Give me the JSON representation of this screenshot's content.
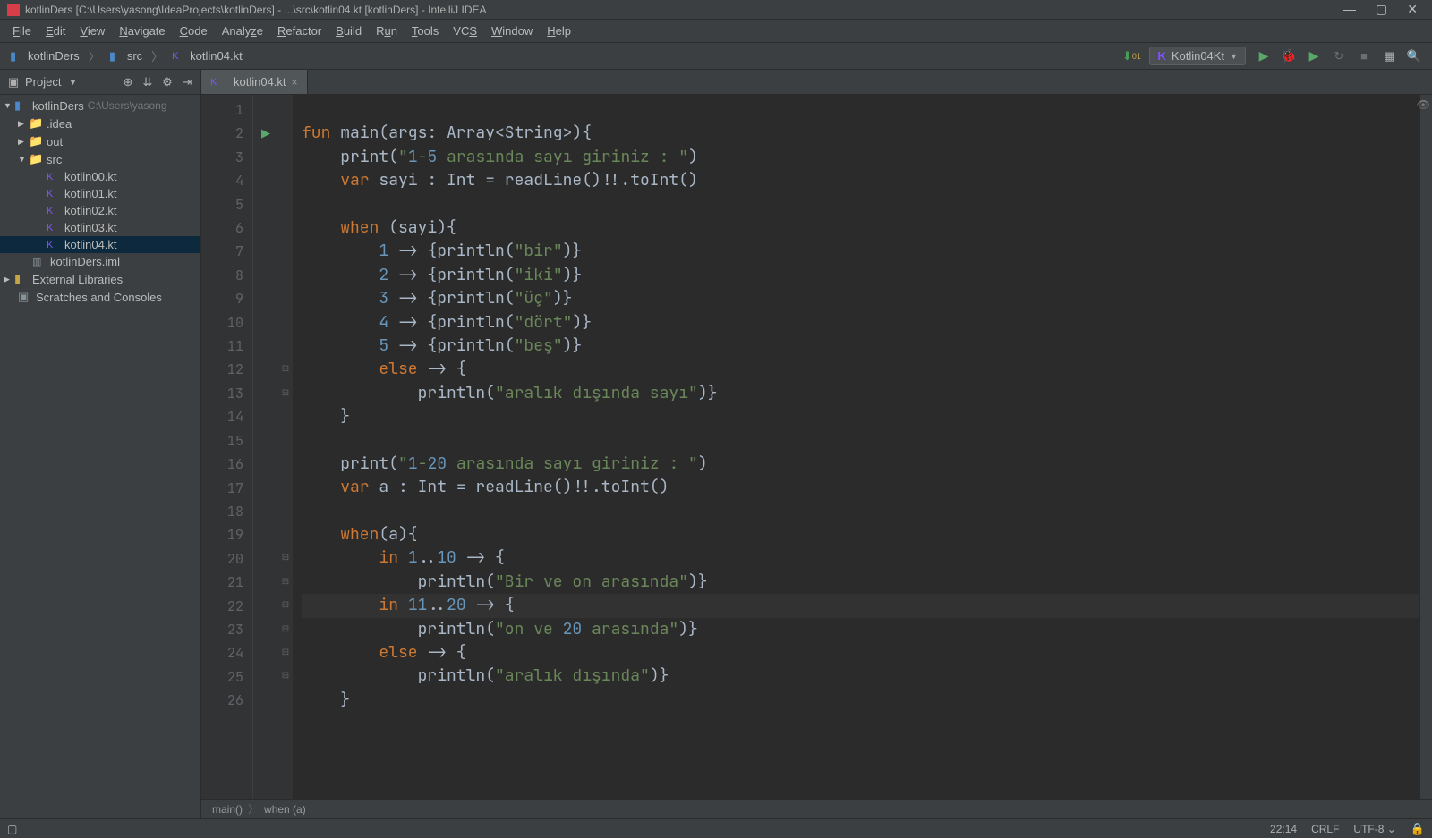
{
  "title": "kotlinDers [C:\\Users\\yasong\\IdeaProjects\\kotlinDers] - ...\\src\\kotlin04.kt [kotlinDers] - IntelliJ IDEA",
  "menu": [
    "File",
    "Edit",
    "View",
    "Navigate",
    "Code",
    "Analyze",
    "Refactor",
    "Build",
    "Run",
    "Tools",
    "VCS",
    "Window",
    "Help"
  ],
  "breadcrumb": {
    "root": "kotlinDers",
    "src": "src",
    "file": "kotlin04.kt"
  },
  "runConfig": "Kotlin04Kt",
  "projectPanel": {
    "label": "Project"
  },
  "tree": {
    "root": "kotlinDers",
    "rootPath": "C:\\Users\\yasong",
    "idea": ".idea",
    "out": "out",
    "src": "src",
    "files": [
      "kotlin00.kt",
      "kotlin01.kt",
      "kotlin02.kt",
      "kotlin03.kt",
      "kotlin04.kt"
    ],
    "iml": "kotlinDers.iml",
    "external": "External Libraries",
    "scratches": "Scratches and Consoles"
  },
  "tabs": {
    "file": "kotlin04.kt"
  },
  "code": {
    "lines": [
      "",
      "fun main(args: Array<String>){",
      "    print(\"1-5 arasında sayı giriniz : \")",
      "    var sayi : Int = readLine()!!.toInt()",
      "",
      "    when (sayi){",
      "        1 -> {println(\"bir\")}",
      "        2 -> {println(\"iki\")}",
      "        3 -> {println(\"üç\")}",
      "        4 -> {println(\"dört\")}",
      "        5 -> {println(\"beş\")}",
      "        else -> {",
      "            println(\"aralık dışında sayı\")}",
      "    }",
      "",
      "    print(\"1-20 arasında sayı giriniz : \")",
      "    var a : Int = readLine()!!.toInt()",
      "",
      "    when(a){",
      "        in 1..10 -> {",
      "            println(\"Bir ve on arasında\")}",
      "        in 11..20 -> {",
      "            println(\"on ve 20 arasında\")}",
      "        else -> {",
      "            println(\"aralık dışında\")}",
      "    }"
    ],
    "startLine": 1
  },
  "editorCrumb": {
    "fn": "main()",
    "block": "when (a)"
  },
  "status": {
    "pos": "22:14",
    "lineEnding": "CRLF",
    "encoding": "UTF-8"
  }
}
